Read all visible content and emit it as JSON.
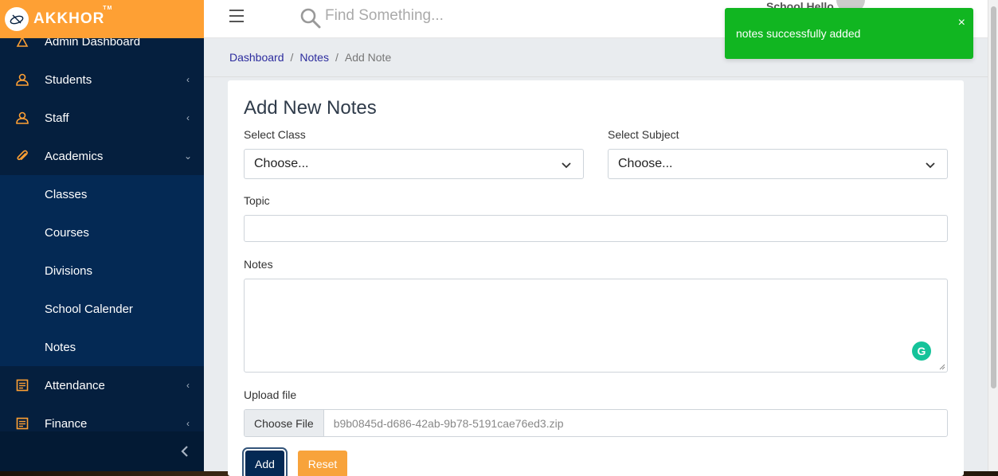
{
  "brand": {
    "name": "AKKHOR",
    "tm": "TM",
    "color": "#fea034"
  },
  "sidebar": {
    "items": [
      {
        "label": "Admin Dashboard",
        "icon": "dashboard-icon"
      },
      {
        "label": "Students",
        "icon": "students-icon",
        "chevron": "‹"
      },
      {
        "label": "Staff",
        "icon": "staff-icon",
        "chevron": "‹"
      },
      {
        "label": "Academics",
        "icon": "paperclip-icon",
        "chevron": "⌄"
      }
    ],
    "sub_items": [
      {
        "label": "Classes"
      },
      {
        "label": "Courses"
      },
      {
        "label": "Divisions"
      },
      {
        "label": "School Calender"
      },
      {
        "label": "Notes"
      }
    ],
    "bottom_items": [
      {
        "label": "Attendance",
        "icon": "list-icon",
        "chevron": "‹"
      },
      {
        "label": "Finance",
        "icon": "list-icon",
        "chevron": "‹"
      }
    ]
  },
  "header": {
    "search_placeholder": "Find Something...",
    "user_name": "School Hello"
  },
  "breadcrumb": {
    "items": [
      "Dashboard",
      "Notes"
    ],
    "separator": "/",
    "current": "Add Note"
  },
  "form": {
    "title": "Add New Notes",
    "class_label": "Select Class",
    "class_value": "Choose...",
    "subject_label": "Select Subject",
    "subject_value": "Choose...",
    "topic_label": "Topic",
    "topic_value": "",
    "notes_label": "Notes",
    "notes_value": "",
    "upload_label": "Upload file",
    "choose_file_label": "Choose File",
    "file_name": "b9b0845d-d686-42ab-9b78-5191cae76ed3.zip",
    "add_label": "Add",
    "reset_label": "Reset"
  },
  "toast": {
    "message": "notes successfully added",
    "close": "×",
    "color": "#11b621"
  }
}
